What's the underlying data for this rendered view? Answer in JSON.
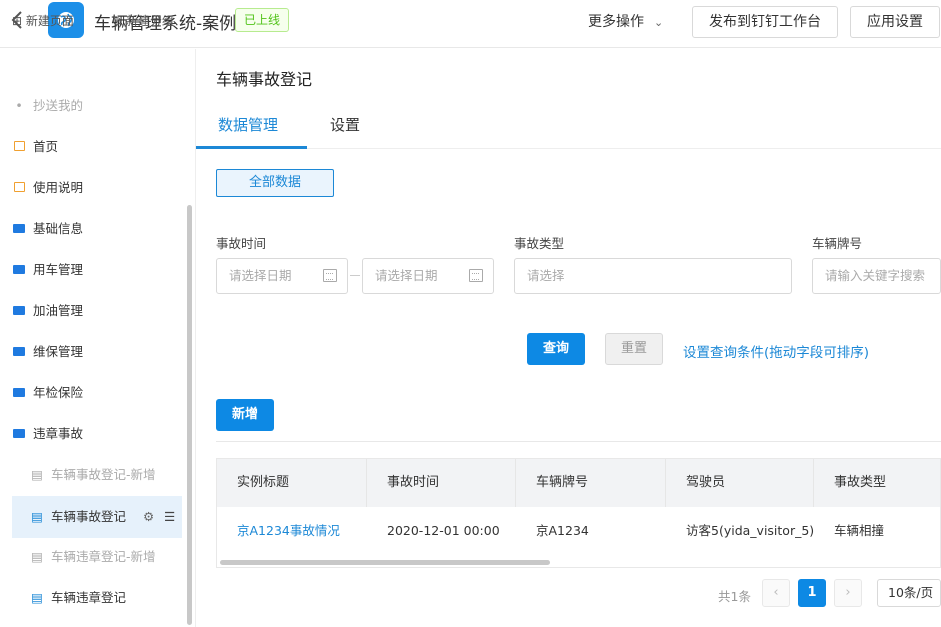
{
  "app": {
    "title": "车辆管理系统-案例",
    "status_badge": "已上线"
  },
  "header": {
    "more_label": "更多操作",
    "publish_label": "发布到钉钉工作台",
    "settings_label": "应用设置"
  },
  "sidebar": {
    "new_page": "新建页面",
    "new_group": "新建分组",
    "items": [
      {
        "label": "抄送我的",
        "icon": "dot-icon"
      },
      {
        "label": "首页",
        "icon": "page-icon"
      },
      {
        "label": "使用说明",
        "icon": "page-icon"
      },
      {
        "label": "基础信息",
        "icon": "folder-icon"
      },
      {
        "label": "用车管理",
        "icon": "folder-icon"
      },
      {
        "label": "加油管理",
        "icon": "folder-icon"
      },
      {
        "label": "维保管理",
        "icon": "folder-icon"
      },
      {
        "label": "年检保险",
        "icon": "folder-icon"
      },
      {
        "label": "违章事故",
        "icon": "folder-open-icon"
      },
      {
        "label": "车辆事故登记-新增",
        "icon": "form-icon"
      },
      {
        "label": "车辆事故登记",
        "icon": "form-icon"
      },
      {
        "label": "车辆违章登记-新增",
        "icon": "form-icon"
      },
      {
        "label": "车辆违章登记",
        "icon": "form-icon"
      }
    ]
  },
  "main": {
    "title": "车辆事故登记",
    "tabs": [
      "数据管理",
      "设置"
    ],
    "filter_button": "全部数据",
    "fields": {
      "time_label": "事故时间",
      "date_placeholder": "请选择日期",
      "type_label": "事故类型",
      "type_placeholder": "请选择",
      "plate_label": "车辆牌号",
      "plate_placeholder": "请输入关键字搜索"
    },
    "query_label": "查询",
    "reset_label": "重置",
    "set_query_label": "设置查询条件(拖动字段可排序)",
    "add_label": "新增",
    "table": {
      "columns": [
        "实例标题",
        "事故时间",
        "车辆牌号",
        "驾驶员",
        "事故类型"
      ],
      "rows": [
        [
          "京A1234事故情况",
          "2020-12-01 00:00",
          "京A1234",
          "访客5(yida_visitor_5)",
          "车辆相撞"
        ]
      ]
    },
    "pagination": {
      "total": "共1条",
      "current": "1",
      "page_size": "10条/页"
    }
  },
  "colors": {
    "accent": "#0d89e4",
    "badge_green": "#52c41a"
  }
}
